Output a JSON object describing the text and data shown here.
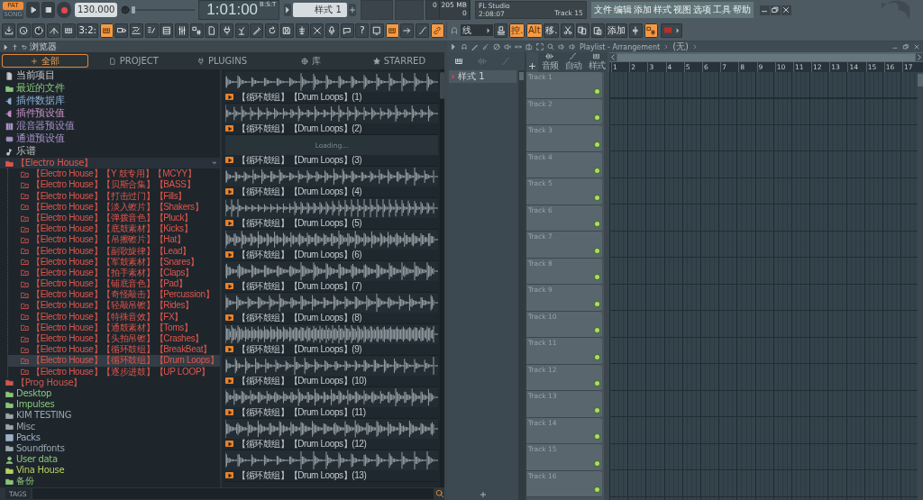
{
  "transport": {
    "modes": [
      {
        "label": "PAT",
        "selected": true
      },
      {
        "label": "SONG",
        "selected": false
      }
    ],
    "playing": false,
    "recording": true,
    "tempo": "130.000",
    "position": {
      "level": 0
    },
    "time": "1:01:00",
    "time_unit": "B:S:T",
    "pattern": "样式 1"
  },
  "readouts": {
    "cpu": "0",
    "memory": "205 MB",
    "polyphony": "0"
  },
  "hint": {
    "title": "FL Studio",
    "time": "2:08:07",
    "detail": "Track 15"
  },
  "menu": [
    "文件",
    "编辑",
    "添加",
    "样式",
    "视图",
    "选项",
    "工具",
    "帮助"
  ],
  "toolbar": [
    {
      "kind": "icon",
      "on": false
    },
    {
      "kind": "icon",
      "on": false
    },
    {
      "kind": "icon",
      "on": false
    },
    {
      "kind": "icon",
      "on": false
    },
    {
      "kind": "icon",
      "on": false
    },
    {
      "kind": "text",
      "label": "3:2:",
      "on": false
    },
    {
      "kind": "icon",
      "on": true
    },
    {
      "kind": "icon",
      "on": false
    },
    {
      "kind": "icon",
      "on": false
    },
    {
      "kind": "icon",
      "on": false
    },
    {
      "kind": "icon",
      "on": false
    },
    {
      "kind": "icon",
      "on": false
    },
    {
      "kind": "icon",
      "on": false
    },
    {
      "kind": "icon",
      "on": false
    },
    {
      "kind": "icon",
      "on": false
    },
    {
      "kind": "icon",
      "on": false
    },
    {
      "kind": "icon",
      "on": false
    },
    {
      "kind": "icon",
      "on": false
    },
    {
      "kind": "icon",
      "on": false
    },
    {
      "kind": "icon",
      "on": false
    },
    {
      "kind": "icon",
      "on": false
    },
    {
      "kind": "icon",
      "on": false
    },
    {
      "kind": "icon",
      "on": false
    },
    {
      "kind": "text",
      "label": "?",
      "on": false
    },
    {
      "kind": "icon",
      "on": false
    },
    {
      "kind": "icon",
      "on": true
    },
    {
      "kind": "icon",
      "on": false
    },
    {
      "kind": "icon",
      "on": false
    },
    {
      "kind": "icon",
      "on": true
    },
    {
      "kind": "magnet"
    },
    {
      "kind": "dropdown",
      "label": "线"
    },
    {
      "kind": "icon",
      "on": false
    },
    {
      "kind": "text",
      "label": "控.",
      "on": true
    },
    {
      "kind": "text",
      "label": "Alt",
      "on": true
    },
    {
      "kind": "text",
      "label": "移.",
      "on": false
    },
    {
      "kind": "icon",
      "on": false
    },
    {
      "kind": "icon",
      "on": false
    },
    {
      "kind": "icon",
      "on": false
    },
    {
      "kind": "text",
      "label": "添加",
      "on": false
    },
    {
      "kind": "icon",
      "on": false
    },
    {
      "kind": "icon",
      "on": true
    },
    {
      "kind": "flag",
      "on": false
    }
  ],
  "browser": {
    "title": "浏览器",
    "tabs": [
      {
        "label": "全部",
        "selected": true
      },
      {
        "label": "PROJECT",
        "selected": false
      },
      {
        "label": "PLUGINS",
        "selected": false
      },
      {
        "label": "库",
        "selected": false
      },
      {
        "label": "STARRED",
        "selected": false
      }
    ],
    "tree": [
      {
        "kind": "project",
        "label": "当前项目",
        "color": "#c8c8c8",
        "selected": false,
        "expanded": false
      },
      {
        "kind": "recent",
        "label": "最近的文件",
        "color": "#8cc57a",
        "selected": false,
        "expanded": false
      },
      {
        "kind": "plugin",
        "label": "插件数据库",
        "color": "#8fb0d8",
        "selected": false,
        "expanded": false
      },
      {
        "kind": "plugin",
        "label": "插件预设值",
        "color": "#c890c4",
        "selected": false,
        "expanded": false
      },
      {
        "kind": "mixer",
        "label": "混音器预设值",
        "color": "#a790c6",
        "selected": false,
        "expanded": false
      },
      {
        "kind": "channel",
        "label": "通道预设值",
        "color": "#a790c6",
        "selected": false,
        "expanded": false
      },
      {
        "kind": "score",
        "label": "乐谱",
        "color": "#c0c0c0",
        "selected": false,
        "expanded": false
      },
      {
        "kind": "folder",
        "label": "【Electro House】",
        "color": "#e0564c",
        "selected": false,
        "expanded": true,
        "children": [
          {
            "label": "【Electro House】【Y 鼓专用】【MCYY】",
            "selected": false
          },
          {
            "label": "【Electro House】【贝斯合集】【BASS】",
            "selected": false
          },
          {
            "label": "【Electro House】【打击过门】【Fills】",
            "selected": false
          },
          {
            "label": "【Electro House】【淡入镲片】【Shakers】",
            "selected": false
          },
          {
            "label": "【Electro House】【弹拨音色】【Pluck】",
            "selected": false
          },
          {
            "label": "【Electro House】【底鼓素材】【Kicks】",
            "selected": false
          },
          {
            "label": "【Electro House】【吊擦镲片】【Hat】",
            "selected": false
          },
          {
            "label": "【Electro House】【副歌旋律】【Lead】",
            "selected": false
          },
          {
            "label": "【Electro House】【军鼓素材】【Snares】",
            "selected": false
          },
          {
            "label": "【Electro House】【拍手素材】【Claps】",
            "selected": false
          },
          {
            "label": "【Electro House】【铺底音色】【Pad】",
            "selected": false
          },
          {
            "label": "【Electro House】【奇怪敲击】【Percussion】",
            "selected": false
          },
          {
            "label": "【Electro House】【轻敲吊镲】【Rides】",
            "selected": false
          },
          {
            "label": "【Electro House】【特殊音效】【FX】",
            "selected": false
          },
          {
            "label": "【Electro House】【通鼓素材】【Toms】",
            "selected": false
          },
          {
            "label": "【Electro House】【头拍吊镲】【Crashes】",
            "selected": false
          },
          {
            "label": "【Electro House】【循环鼓组】【BreakBeat】",
            "selected": false
          },
          {
            "label": "【Electro House】【循环鼓组】【Drum Loops】",
            "selected": true
          },
          {
            "label": "【Electro House】【逐步进鼓】【UP LOOP】",
            "selected": false
          }
        ]
      },
      {
        "kind": "folder",
        "label": "【Prog House】",
        "color": "#d0574e",
        "selected": false,
        "expanded": false
      },
      {
        "kind": "folder",
        "label": "Desktop",
        "color": "#8cc57a",
        "selected": false,
        "expanded": false
      },
      {
        "kind": "folder",
        "label": "Impulses",
        "color": "#8cc57a",
        "selected": false,
        "expanded": false
      },
      {
        "kind": "folder",
        "label": "KIM TESTING",
        "color": "#9aa6ae",
        "selected": false,
        "expanded": false
      },
      {
        "kind": "folder",
        "label": "Misc",
        "color": "#9aa6ae",
        "selected": false,
        "expanded": false
      },
      {
        "kind": "packs",
        "label": "Packs",
        "color": "#9db2c9",
        "selected": false,
        "expanded": false
      },
      {
        "kind": "folder",
        "label": "Soundfonts",
        "color": "#9aa6ae",
        "selected": false,
        "expanded": false
      },
      {
        "kind": "user",
        "label": "User data",
        "color": "#8cc57a",
        "selected": false,
        "expanded": false
      },
      {
        "kind": "folder",
        "label": "Vina House",
        "color": "#b9d25e",
        "selected": false,
        "expanded": false
      },
      {
        "kind": "recent",
        "label": "备份",
        "color": "#8cc57a",
        "selected": false,
        "expanded": false
      }
    ],
    "samples": [
      {
        "kind": "wave",
        "label": "【循环鼓组】【Drum Loops】(1)"
      },
      {
        "kind": "wave",
        "label": "【循环鼓组】【Drum Loops】(2)"
      },
      {
        "kind": "loading",
        "status": "Loading...",
        "label": "【循环鼓组】【Drum Loops】(3)"
      },
      {
        "kind": "wave",
        "label": "【循环鼓组】【Drum Loops】(4)"
      },
      {
        "kind": "wave",
        "label": "【循环鼓组】【Drum Loops】(5)"
      },
      {
        "kind": "wave",
        "label": "【循环鼓组】【Drum Loops】(6)"
      },
      {
        "kind": "wave",
        "label": "【循环鼓组】【Drum Loops】(7)"
      },
      {
        "kind": "wave",
        "label": "【循环鼓组】【Drum Loops】(8)"
      },
      {
        "kind": "wave",
        "label": "【循环鼓组】【Drum Loops】(9)"
      },
      {
        "kind": "wave",
        "label": "【循环鼓组】【Drum Loops】(10)"
      },
      {
        "kind": "wave",
        "label": "【循环鼓组】【Drum Loops】(11)"
      },
      {
        "kind": "wave",
        "label": "【循环鼓组】【Drum Loops】(12)"
      },
      {
        "kind": "wave",
        "label": "【循环鼓组】【Drum Loops】(13)"
      }
    ],
    "tags_label": "TAGS"
  },
  "playlist": {
    "title": "Playlist - Arrangement",
    "breadcrumb": "(无)",
    "patterns": [
      {
        "label": "样式 1",
        "selected": true
      }
    ],
    "tool_labels": [
      "音频",
      "自动",
      "样式"
    ],
    "bars": [
      "1",
      "2",
      "3",
      "4",
      "5",
      "6",
      "7",
      "8",
      "9",
      "10",
      "11",
      "12",
      "13",
      "14",
      "15",
      "16",
      "17"
    ],
    "tracks": [
      "Track 1",
      "Track 2",
      "Track 3",
      "Track 4",
      "Track 5",
      "Track 6",
      "Track 7",
      "Track 8",
      "Track 9",
      "Track 10",
      "Track 11",
      "Track 12",
      "Track 13",
      "Track 14",
      "Track 15",
      "Track 16"
    ]
  }
}
